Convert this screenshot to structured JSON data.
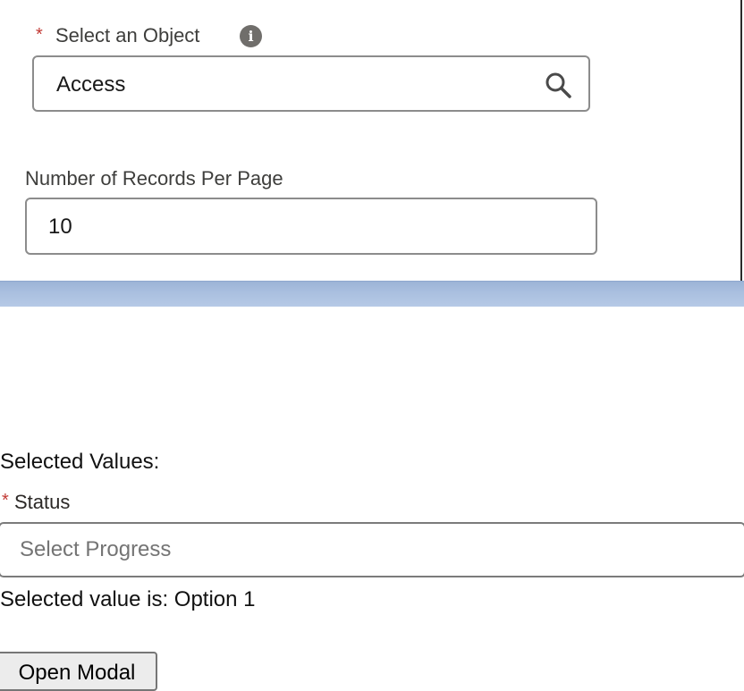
{
  "object_field": {
    "required_marker": "*",
    "label": "Select an Object",
    "info_icon": "info-icon",
    "value": "Access",
    "search_icon": "search-icon"
  },
  "records_field": {
    "label": "Number of Records Per Page",
    "value": "10"
  },
  "selection": {
    "heading": "Selected Values:",
    "status_required_marker": "*",
    "status_label": "Status",
    "status_placeholder": "Select Progress",
    "selected_text": "Selected value is: Option 1"
  },
  "actions": {
    "open_modal_label": "Open Modal"
  },
  "colors": {
    "required": "#c23934",
    "divider": "#a9bfdf",
    "border": "#8c8c8c"
  }
}
